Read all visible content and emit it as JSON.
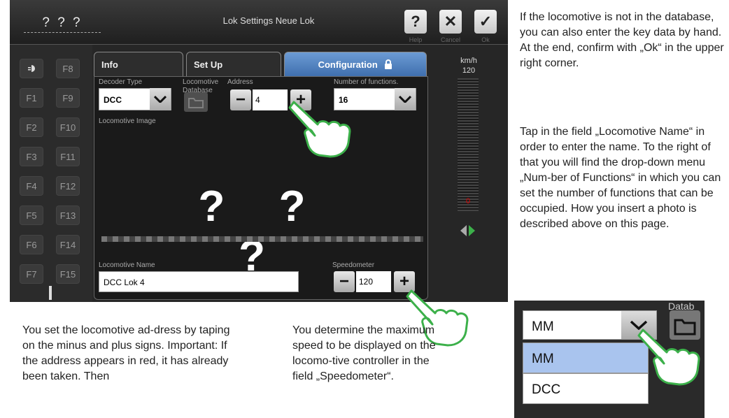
{
  "titlebar": {
    "loco_name": "? ? ?",
    "title": "Lok Settings Neue Lok",
    "help_label": "Help",
    "cancel_label": "Cancel",
    "ok_label": "Ok",
    "help_glyph": "?",
    "cancel_glyph": "✕",
    "ok_glyph": "✓"
  },
  "function_keys": {
    "left": [
      "",
      "F1",
      "F2",
      "F3",
      "F4",
      "F5",
      "F6",
      "F7"
    ],
    "right": [
      "F8",
      "F9",
      "F10",
      "F11",
      "F12",
      "F13",
      "F14",
      "F15"
    ]
  },
  "tabs": [
    {
      "label": "Info"
    },
    {
      "label": "Set Up"
    },
    {
      "label": "Configuration",
      "active": true
    }
  ],
  "config": {
    "decoder_type_label": "Decoder Type",
    "decoder_type_value": "DCC",
    "loco_db_label": "Locomotive Database",
    "address_label": "Address",
    "address_value": "4",
    "num_functions_label": "Number of functions.",
    "num_functions_value": "16",
    "image_label": "Locomotive Image",
    "image_placeholder": "? ? ?",
    "name_label": "Locomotive Name",
    "name_value": "DCC Lok 4",
    "speedo_label": "Speedometer",
    "speedo_value": "120",
    "minus": "−",
    "plus": "+"
  },
  "speed": {
    "unit": "km/h",
    "max": "120",
    "current": "0"
  },
  "text": {
    "right_p1": "If the locomotive is not in the database, you can also enter the key data by hand. At the end, confirm with „Ok“ in the upper right corner.",
    "right_p2": "Tap in the field „Locomotive Name“ in order to enter the name. To the right of that you will find the drop-down menu „Num-ber of Functions“ in which you can set the number of functions that can be occupied. How you insert a photo is described above on this page.",
    "bottom_left": "You set the locomotive ad-dress by taping on the minus and plus signs. Important: If the address appears in red, it has already been taken. Then",
    "bottom_mid": "You determine the maximum speed to be displayed on the locomo-tive controller in the field „Speedometer“."
  },
  "inset": {
    "selected": "MM",
    "options": [
      "MM",
      "DCC"
    ],
    "db_label": "Datab"
  },
  "colors": {
    "accent_blue": "#4f7fc0",
    "hand_green": "#3cb04a",
    "speed_red": "#d00000"
  }
}
